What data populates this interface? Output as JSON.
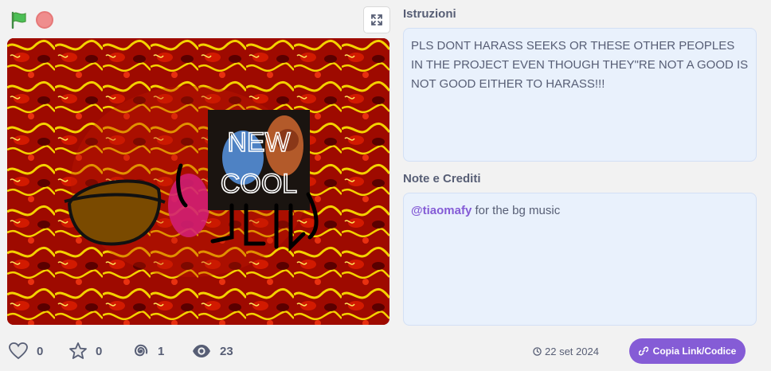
{
  "controls": {
    "flag_icon": "green-flag-icon",
    "stop_icon": "stop-icon",
    "fullscreen_icon": "fullscreen-icon",
    "flag_color": "#4cbf56",
    "stop_color": "#ec6b6b"
  },
  "stage": {
    "overlay_line1": "NEW",
    "overlay_line2": "COOL"
  },
  "instructions": {
    "title": "Istruzioni",
    "text": "PLS DONT HARASS SEEKS OR THESE OTHER PEOPLES IN THE PROJECT EVEN THOUGH THEY\"RE NOT A GOOD IS NOT GOOD EITHER TO HARASS!!!"
  },
  "notes": {
    "title": "Note e Crediti",
    "mention": "@tiaomafy",
    "text": " for the bg music"
  },
  "stats": {
    "loves": "0",
    "favorites": "0",
    "remixes": "1",
    "views": "23"
  },
  "date": "22 set 2024",
  "copy_button": "Copia Link/Codice",
  "colors": {
    "accent": "#855cd6",
    "panel_bg": "#e9f1fc",
    "text": "#575e75"
  }
}
